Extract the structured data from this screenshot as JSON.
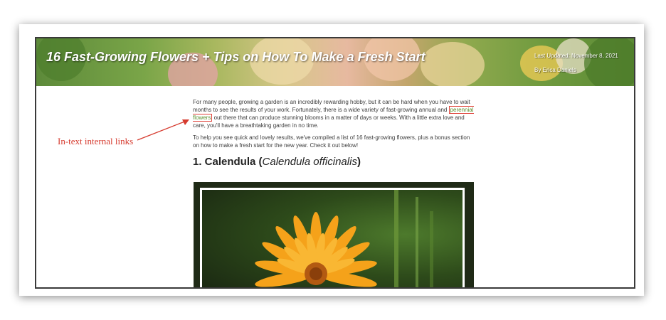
{
  "article": {
    "title": "16 Fast-Growing Flowers + Tips on How To Make a Fresh Start",
    "last_updated": "Last Updated: November 8, 2021",
    "author": "By Erica Daniels",
    "para1_before": "For many people, growing a garden is an incredibly rewarding hobby, but it can be hard when you have to wait months to see the results of your work. Fortunately, there is a wide variety of fast-growing annual and ",
    "link_text": "perennial flowers",
    "para1_after": " out there that can produce stunning blooms in a matter of days or weeks. With a little extra love and care, you'll have a breathtaking garden in no time.",
    "para2": "To help you see quick and lovely results, we've compiled a list of 16 fast-growing flowers, plus a bonus section on how to make a fresh start for the new year. Check it out below!",
    "heading_prefix": "1. Calendula (",
    "heading_latin": "Calendula officinalis",
    "heading_suffix": ")"
  },
  "annotation": {
    "label": "In-text internal links",
    "color": "#d63b2f"
  },
  "colors": {
    "link": "#5a8f2e",
    "highlight_box": "#e0443a",
    "flower": "#f5a21a"
  }
}
